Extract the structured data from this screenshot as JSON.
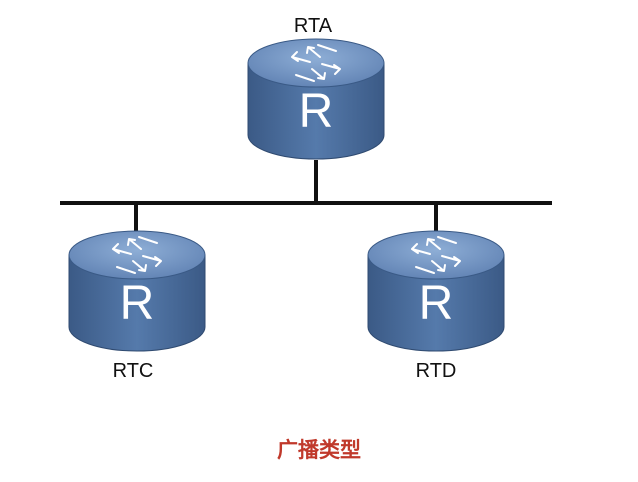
{
  "routers": [
    {
      "id": "rta",
      "name": "RTA",
      "glyph": "R"
    },
    {
      "id": "rtc",
      "name": "RTC",
      "glyph": "R"
    },
    {
      "id": "rtd",
      "name": "RTD",
      "glyph": "R"
    }
  ],
  "caption": "广播类型",
  "icon": "router-icon",
  "colors": {
    "router_body": "#4d6c98",
    "router_top": "#6283b4",
    "router_top_light": "#7fa0cc",
    "line": "#111111",
    "caption": "#c0392b"
  }
}
